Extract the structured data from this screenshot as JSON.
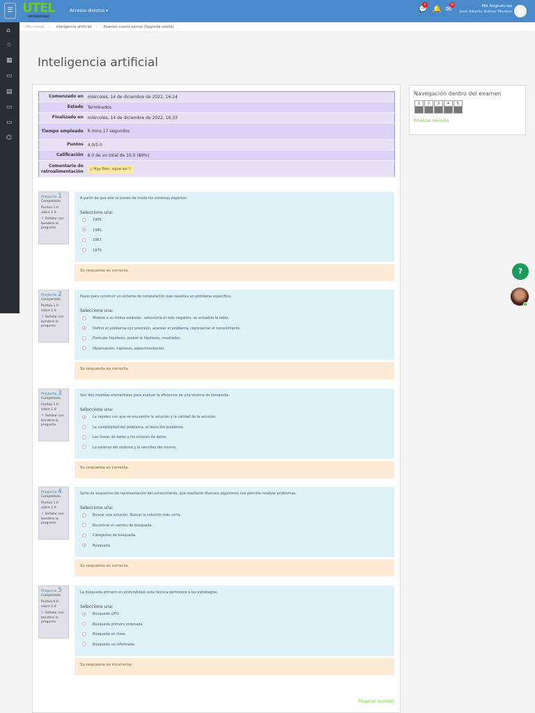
{
  "header": {
    "logo": "UTEL",
    "logo_sub": "UNIVERSIDAD",
    "shortcuts": "Accesos directos ▾",
    "msg_badge": "8",
    "mail_badge": "30",
    "user_title": "Mis Asignaturas",
    "user_name": "José Alberto Ibáñez Moreno"
  },
  "breadcrumb": [
    "Mis cursos",
    "Inteligencia artificial",
    "Examen cuarto parcial (Segunda vuelta)"
  ],
  "page_title": "Inteligencia artificial",
  "summary": [
    {
      "k": "Comenzado en",
      "v": "miércoles, 14 de diciembre de 2022, 16:24"
    },
    {
      "k": "Estado",
      "v": "Terminados"
    },
    {
      "k": "Finalizado en",
      "v": "miércoles, 14 de diciembre de 2022, 16:33"
    },
    {
      "k": "Tiempo empleado",
      "v": "9 mins 17 segundos"
    },
    {
      "k": "Puntos",
      "v": "4.0/5.0"
    },
    {
      "k": "Calificación",
      "v": "8.0 de un total de 10.0 (80%)"
    },
    {
      "k": "Comentario de retroalimentación",
      "v": "¡¡ Muy Bien, sigue así !!"
    }
  ],
  "question_label": "Pregunta",
  "select_label": "Seleccione una:",
  "flag_label": "Señalar con bandera la pregunta",
  "questions": [
    {
      "n": "1",
      "state": "Completada",
      "score": "Puntúa 1.0 sobre 1.0",
      "text": "A partir de qué año se ponen de moda los sistemas expertos.",
      "options": [
        "1965.",
        "1980.",
        "1967.",
        "1970."
      ],
      "selected": 1,
      "feedback": "Su respuesta es correcta."
    },
    {
      "n": "2",
      "state": "Completada",
      "score": "Puntúa 1.0 sobre 1.0",
      "text": "Pasos para construir un sistema de computación que resuelva un problema específico:",
      "options": [
        "Modelo a su forma estándar, selecciona el más negativo, se actualiza la tabla.",
        "Definir el problema con precisión, analizar el problema, representar el conocimiento.",
        "Formular hipótesis, probar la hipótesis, resultados.",
        "Observación, hipótesis, experimentación."
      ],
      "selected": 1,
      "feedback": "Su respuesta es correcta."
    },
    {
      "n": "3",
      "state": "Completada",
      "score": "Puntúa 1.0 sobre 1.0",
      "text": "Son dos medidas elementales para evaluar la eficiencia de una técnica de búsqueda:",
      "options": [
        "La rapidez con que se encuentre la solución y la calidad de la solución.",
        "La complejidad del problema, el texto del problema.",
        "Las líneas de datos y los enlaces de datos.",
        "Lo extenso del sistema y la sencillez del mismo."
      ],
      "selected": 0,
      "feedback": "Su respuesta es correcta."
    },
    {
      "n": "4",
      "state": "Completada",
      "score": "Puntúa 1.0 sobre 1.0",
      "text": "Serie de esquemas de representación del conocimiento, que mediante diversos algoritmos nos permite resolver problemas.",
      "options": [
        "Buscar una solución, Buscar la solución más corta.",
        "Encontrar el camino de búsqueda.",
        "Categorías de búsqueda.",
        "Búsqueda."
      ],
      "selected": 3,
      "feedback": "Su respuesta es correcta."
    },
    {
      "n": "5",
      "state": "Completada",
      "score": "Puntúa 0.0 sobre 1.0",
      "text": "La búsqueda primero en profundidad, esta técnica pertenece a las estrategias.",
      "options": [
        "Búsqueda LIFO.",
        "Búsqueda primero ordenada.",
        "Búsqueda en línea.",
        "Búsqueda no informada."
      ],
      "selected": 0,
      "feedback": "Su respuesta es incorrecta."
    }
  ],
  "finish_review": "Finalizar revisión",
  "quiz_nav": {
    "title": "Navegación dentro del examen",
    "buttons": [
      "1",
      "2",
      "3",
      "4",
      "5"
    ],
    "finish": "Finalizar revisión"
  },
  "help": "?"
}
